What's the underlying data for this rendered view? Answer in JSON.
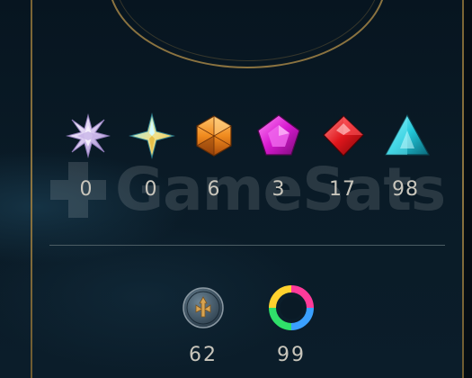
{
  "loot": {
    "essences": [
      {
        "name": "mythic-essence",
        "count": "0"
      },
      {
        "name": "blue-essence",
        "count": "0"
      },
      {
        "name": "orange-essence",
        "count": "6"
      },
      {
        "name": "gemstone",
        "count": "3"
      },
      {
        "name": "red-gem",
        "count": "17"
      },
      {
        "name": "cyan-gem",
        "count": "98"
      }
    ],
    "tokens": [
      {
        "name": "emote-token",
        "count": "62"
      },
      {
        "name": "chroma-wheel",
        "count": "99"
      }
    ]
  },
  "watermark": {
    "text": "GameSats"
  },
  "colors": {
    "frame_gold": "#8b7340",
    "background": "#0a1a26",
    "count_text": "#c9c6bc"
  }
}
